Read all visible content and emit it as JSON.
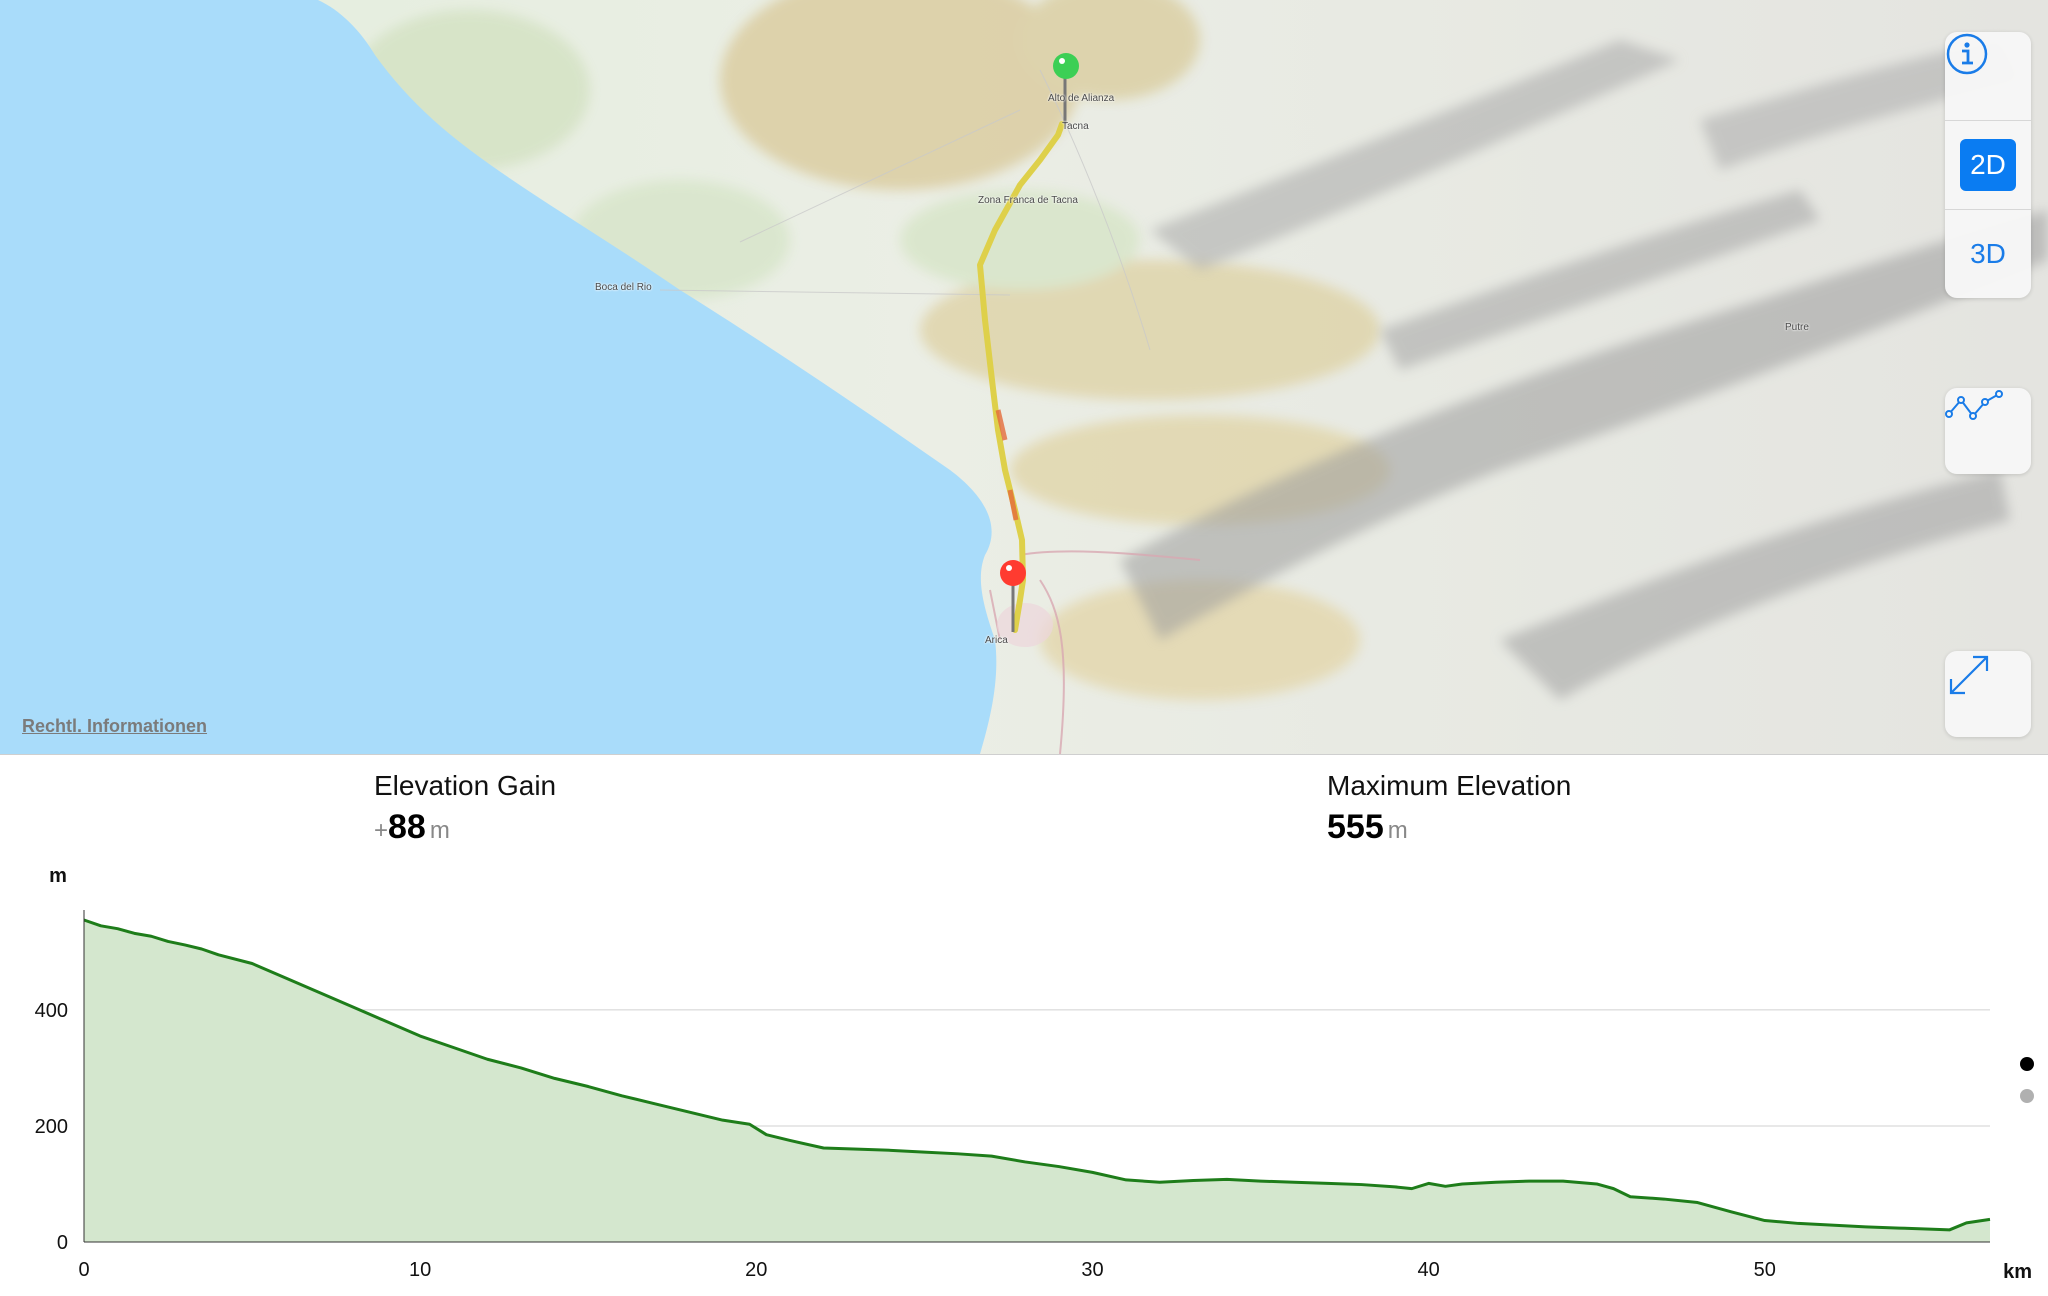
{
  "map": {
    "legal_link": "Rechtl. Informationen",
    "places": [
      {
        "name": "Alto de Alianza"
      },
      {
        "name": "Tacna"
      },
      {
        "name": "Zona Franca de Tacna"
      },
      {
        "name": "Boca del Rio"
      },
      {
        "name": "Putre"
      },
      {
        "name": "Arica"
      }
    ],
    "start_marker_color": "#3ccf55",
    "end_marker_color": "#ff3b30",
    "sea_color": "#a9dcfa",
    "route_color": "#d8b52a"
  },
  "controls": {
    "info_icon": "info-circle-icon",
    "mode_2d": "2D",
    "mode_3d": "3D",
    "active_mode": "2D",
    "elevation_icon": "elevation-graph-icon",
    "expand_icon": "expand-arrows-icon",
    "accent_color": "#0a7cf2"
  },
  "stats": {
    "gain": {
      "label": "Elevation Gain",
      "prefix": "+",
      "value": "88",
      "unit": "m"
    },
    "max": {
      "label": "Maximum Elevation",
      "value": "555",
      "unit": "m"
    }
  },
  "page_indicator": {
    "count": 2,
    "active": 0
  },
  "chart_data": {
    "type": "area",
    "ylabel": "m",
    "xlabel": "km",
    "xlim": [
      0,
      56.7
    ],
    "ylim": [
      0,
      555
    ],
    "x_ticks": [
      0,
      10,
      20,
      30,
      40,
      50
    ],
    "y_ticks": [
      0,
      200,
      400
    ],
    "line_color": "#1e7d1a",
    "fill_color": "#d4e7ce",
    "series": [
      {
        "x": [
          0,
          0.5,
          1,
          1.5,
          2,
          2.5,
          3,
          3.5,
          4,
          5,
          6,
          7,
          8,
          9,
          10,
          11,
          12,
          13,
          14,
          15,
          16,
          17,
          18,
          19,
          19.8,
          20.3,
          21,
          22,
          23,
          24,
          25,
          26,
          27,
          28,
          29,
          30,
          31,
          32,
          33,
          34,
          35,
          36,
          37,
          38,
          39,
          39.5,
          40,
          40.5,
          41,
          42,
          43,
          44,
          45,
          45.5,
          46,
          47,
          48,
          49,
          50,
          51,
          52,
          53,
          54,
          55,
          55.5,
          56,
          56.7
        ],
        "y": [
          555,
          545,
          540,
          532,
          527,
          518,
          512,
          505,
          495,
          480,
          455,
          430,
          405,
          380,
          355,
          335,
          315,
          300,
          282,
          268,
          252,
          238,
          224,
          210,
          203,
          185,
          175,
          162,
          160,
          158,
          155,
          152,
          148,
          138,
          130,
          120,
          107,
          103,
          106,
          108,
          105,
          103,
          101,
          99,
          95,
          92,
          101,
          96,
          100,
          103,
          105,
          105,
          100,
          92,
          78,
          74,
          68,
          52,
          37,
          32,
          29,
          26,
          24,
          22,
          21,
          33,
          39
        ]
      }
    ]
  }
}
